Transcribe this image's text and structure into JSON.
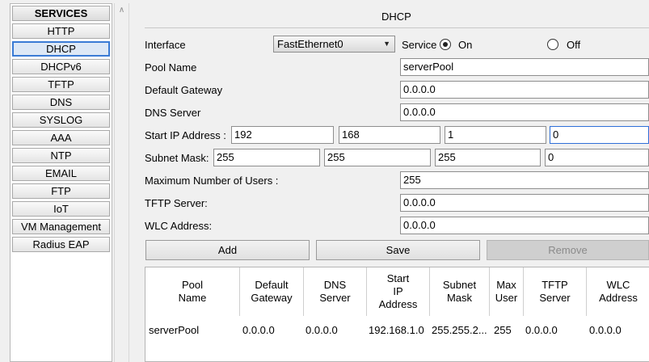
{
  "sidebar": {
    "header": "SERVICES",
    "items": [
      "HTTP",
      "DHCP",
      "DHCPv6",
      "TFTP",
      "DNS",
      "SYSLOG",
      "AAA",
      "NTP",
      "EMAIL",
      "FTP",
      "IoT",
      "VM Management",
      "Radius EAP"
    ],
    "selected": "DHCP"
  },
  "panel": {
    "title": "DHCP",
    "interface_label": "Interface",
    "interface_value": "FastEthernet0",
    "service_label": "Service",
    "on_label": "On",
    "off_label": "Off",
    "service_state": "On",
    "pool_name_label": "Pool Name",
    "pool_name_value": "serverPool",
    "default_gateway_label": "Default Gateway",
    "default_gateway_value": "0.0.0.0",
    "dns_server_label": "DNS Server",
    "dns_server_value": "0.0.0.0",
    "start_ip_label": "Start IP Address :",
    "start_ip": [
      "192",
      "168",
      "1",
      "0"
    ],
    "subnet_mask_label": "Subnet Mask:",
    "subnet_mask": [
      "255",
      "255",
      "255",
      "0"
    ],
    "max_users_label": "Maximum Number of Users :",
    "max_users_value": "255",
    "tftp_label": "TFTP Server:",
    "tftp_value": "0.0.0.0",
    "wlc_label": "WLC Address:",
    "wlc_value": "0.0.0.0",
    "buttons": {
      "add": "Add",
      "save": "Save",
      "remove": "Remove"
    }
  },
  "table": {
    "headers": [
      "Pool\nName",
      "Default\nGateway",
      "DNS\nServer",
      "Start\nIP\nAddress",
      "Subnet\nMask",
      "Max\nUser",
      "TFTP\nServer",
      "WLC\nAddress"
    ],
    "rows": [
      [
        "serverPool",
        "0.0.0.0",
        "0.0.0.0",
        "192.168.1.0",
        "255.255.2...",
        "255",
        "0.0.0.0",
        "0.0.0.0"
      ]
    ]
  },
  "colors": {
    "selected_border": "#3a7bd5",
    "focus_border": "#2f6fd8",
    "disabled_button": "#cfcfcf"
  }
}
